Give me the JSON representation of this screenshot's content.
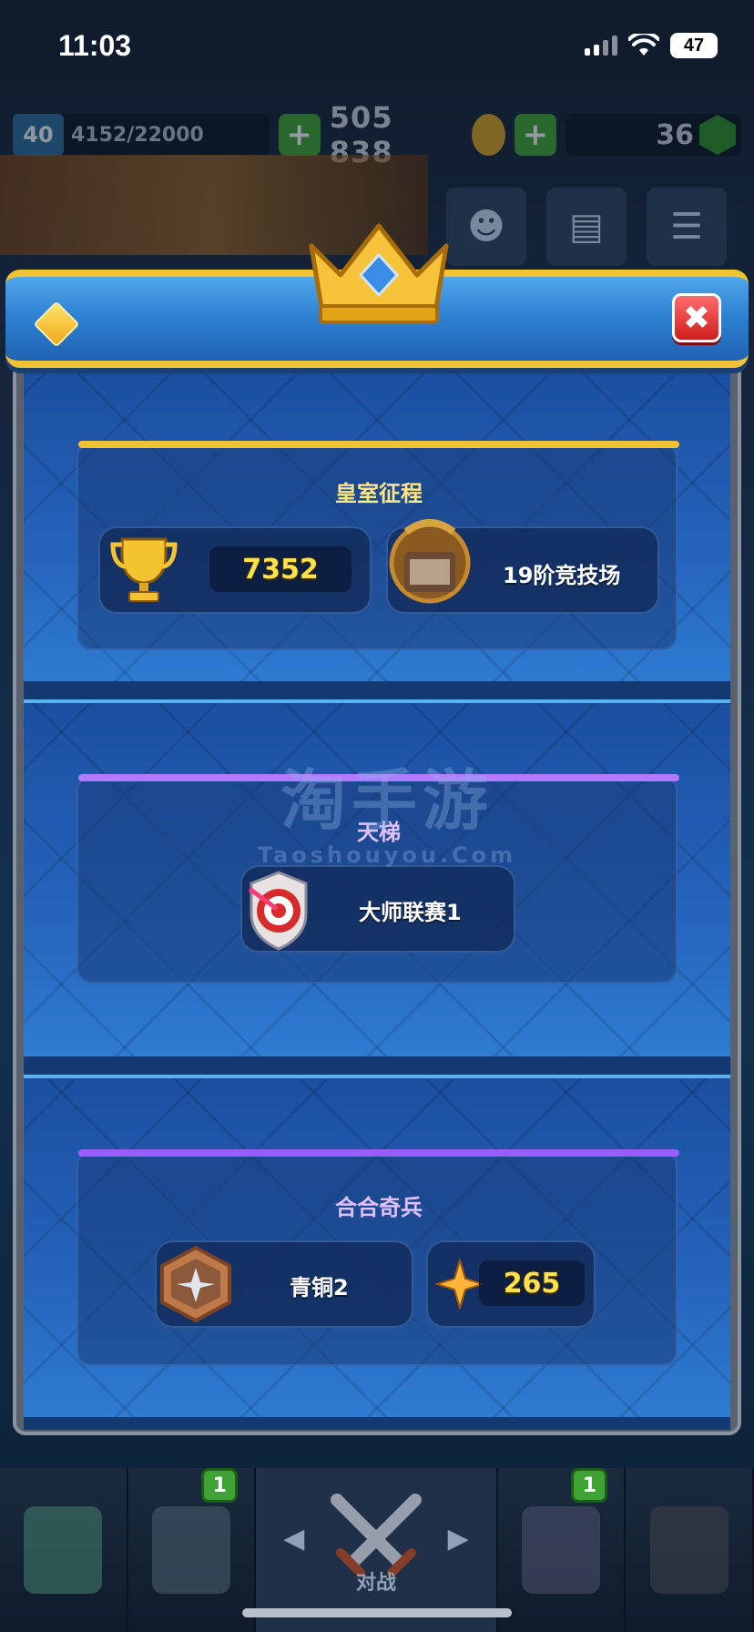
{
  "status_bar": {
    "time": "11:03",
    "battery": "47"
  },
  "resources": {
    "level": "40",
    "xp": "4152/22000",
    "gold": "505 838",
    "gems": "36"
  },
  "modal": {
    "sections": [
      {
        "title": "皇室征程",
        "accent": "#f1c232",
        "trophies": "7352",
        "arena": "19阶竞技场"
      },
      {
        "title": "天梯",
        "accent": "#b27bff",
        "league": "大师联赛1"
      },
      {
        "title": "合合奇兵",
        "accent": "#9a5cff",
        "rank": "青铜2",
        "points": "265"
      }
    ]
  },
  "watermark": {
    "cn": "淘手游",
    "en": "Taoshouyou.Com"
  },
  "bottom_nav": {
    "cards_badge": "1",
    "battle_label": "对战",
    "clan_badge": "1"
  },
  "icons": [
    "trophy-icon",
    "arena-icon",
    "league-target-icon",
    "bronze-rank-icon",
    "star-points-icon",
    "crown-gem-icon",
    "close-icon",
    "diamond-icon"
  ]
}
